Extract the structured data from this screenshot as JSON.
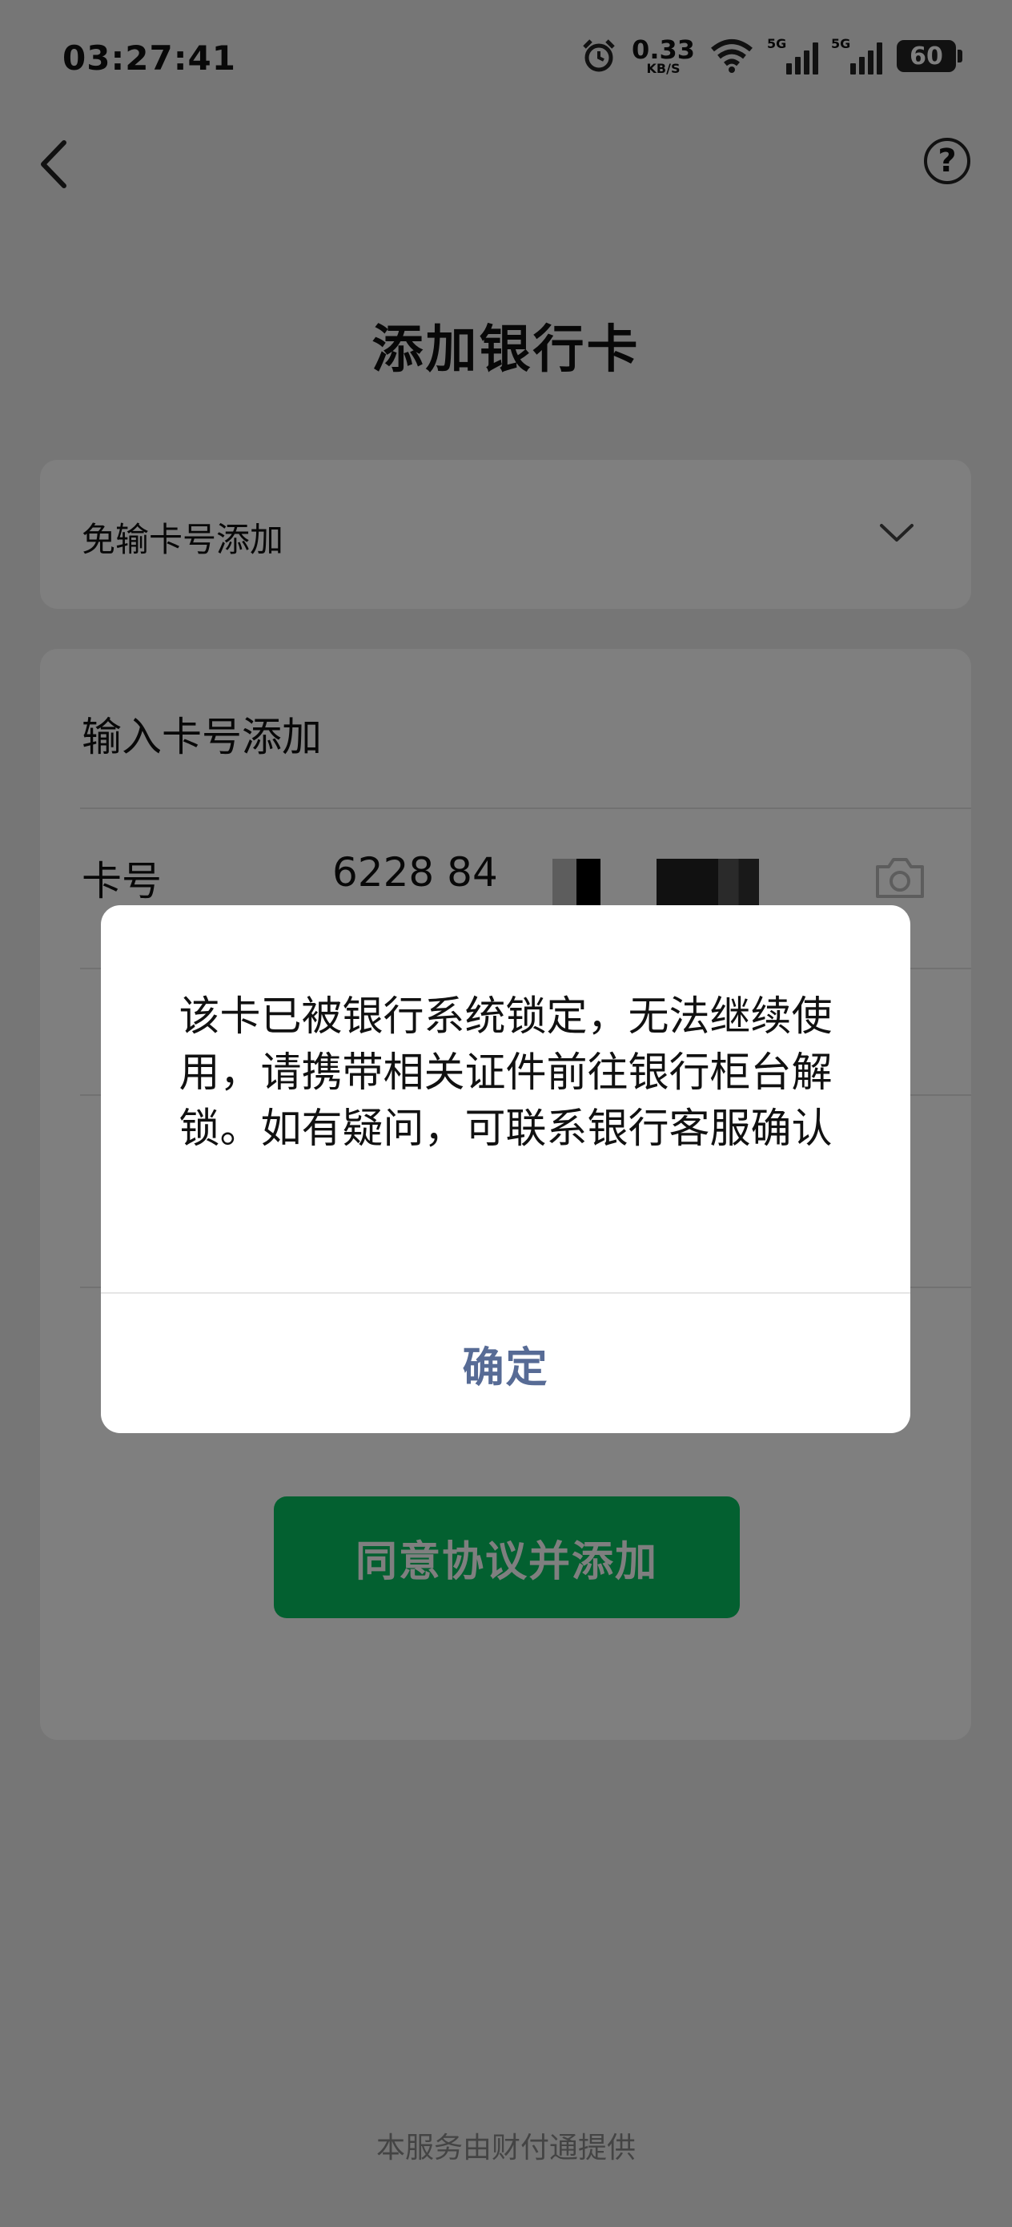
{
  "status_bar": {
    "time": "03:27:41",
    "net_speed_value": "0.33",
    "net_speed_unit": "KB/S",
    "signal_1_tag": "5G",
    "signal_2_tag": "5G",
    "battery": "60"
  },
  "nav": {
    "back_icon": "chevron-left-icon",
    "help_icon": "question-circle-icon",
    "help_glyph": "?"
  },
  "page": {
    "title": "添加银行卡"
  },
  "quick_add": {
    "label": "免输卡号添加",
    "icon": "chevron-down-icon"
  },
  "manual_add": {
    "section_title": "输入卡号添加",
    "card_number_label": "卡号",
    "card_number_value": "6228 84",
    "camera_icon": "camera-icon"
  },
  "primary_button": {
    "label": "同意协议并添加",
    "color": "#07c160"
  },
  "footer": {
    "text": "本服务由财付通提供"
  },
  "dialog": {
    "message": "该卡已被银行系统锁定，无法继续使用，请携带相关证件前往银行柜台解锁。如有疑问，可联系银行客服确认",
    "confirm_label": "确定",
    "confirm_color": "#576b95"
  }
}
